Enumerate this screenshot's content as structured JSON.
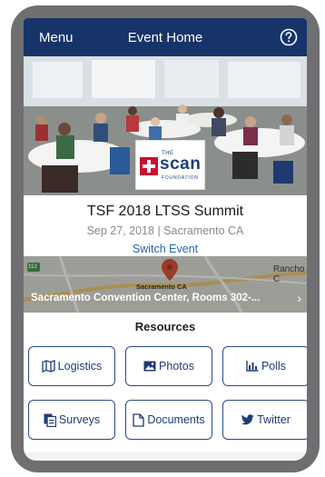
{
  "navbar": {
    "menu_label": "Menu",
    "title": "Event Home",
    "help_icon": "question-circle-icon"
  },
  "event": {
    "name": "TSF 2018 LTSS Summit",
    "date_location": "Sep 27, 2018 | Sacramento CA",
    "switch_label": "Switch Event"
  },
  "logo": {
    "the": "THE",
    "name": "scan",
    "tagline": "FOUNDATION"
  },
  "map": {
    "address": "Sacramento Convention Center, Rooms 302-...",
    "city_label": "Sacramento CA",
    "place_label": "Rancho C",
    "route_badge": "113"
  },
  "resources": {
    "title": "Resources",
    "items": [
      {
        "label": "Logistics",
        "icon": "map-icon"
      },
      {
        "label": "Photos",
        "icon": "image-icon"
      },
      {
        "label": "Polls",
        "icon": "bar-chart-icon"
      },
      {
        "label": "Surveys",
        "icon": "clipboard-icon"
      },
      {
        "label": "Documents",
        "icon": "document-icon"
      },
      {
        "label": "Twitter",
        "icon": "twitter-icon"
      }
    ]
  },
  "colors": {
    "navbar": "#17346a",
    "accent": "#2563b5",
    "tile_border": "#2b4a8a",
    "map_pin": "#d9452c"
  }
}
